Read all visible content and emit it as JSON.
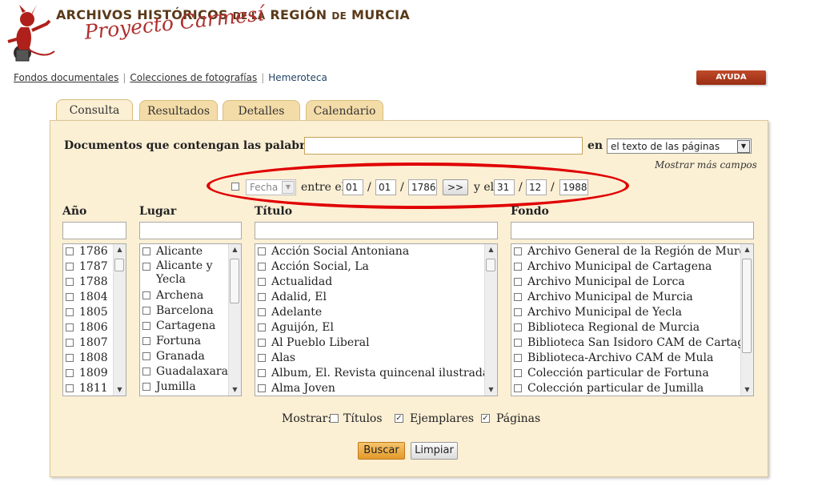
{
  "header": {
    "title_a": "ARCHIVOS HISTÓRICOS",
    "title_de1": "DE LA",
    "title_b": "REGIÓN",
    "title_de2": "DE",
    "title_c": "MURCIA",
    "subtitle": "Proyecto Carmesí"
  },
  "nav": {
    "items": [
      "Fondos documentales",
      "Colecciones de fotografías",
      "Hemeroteca"
    ],
    "help_label": "AYUDA"
  },
  "tabs": [
    "Consulta",
    "Resultados",
    "Detalles",
    "Calendario"
  ],
  "search": {
    "label": "Documentos que contengan las palabras",
    "value": "",
    "in_label": "en",
    "scope_value": "el texto de las páginas",
    "more_fields": "Mostrar más campos"
  },
  "date_filter": {
    "type_value": "Fecha",
    "between_label": "entre el",
    "from_day": "01",
    "from_month": "01",
    "from_year": "1786",
    "sep": "/",
    "jump_label": ">>",
    "and_label": "y el",
    "to_day": "31",
    "to_month": "12",
    "to_year": "1988"
  },
  "columns": {
    "year": {
      "title": "Año",
      "items": [
        "1786",
        "1787",
        "1788",
        "1804",
        "1805",
        "1806",
        "1807",
        "1808",
        "1809",
        "1811"
      ]
    },
    "place": {
      "title": "Lugar",
      "items": [
        "Alicante",
        "Alicante y Yecla",
        "Archena",
        "Barcelona",
        "Cartagena",
        "Fortuna",
        "Granada",
        "Guadalaxara",
        "Jumilla"
      ]
    },
    "title_col": {
      "title": "Título",
      "items": [
        "Acción Social Antoniana",
        "Acción Social, La",
        "Actualidad",
        "Adalid, El",
        "Adelante",
        "Aguijón, El",
        "Al Pueblo Liberal",
        "Alas",
        "Album, El. Revista quincenal ilustrada.",
        "Alma Joven"
      ]
    },
    "fund": {
      "title": "Fondo",
      "items": [
        "Archivo General de la Región de Murcia",
        "Archivo Municipal de Cartagena",
        "Archivo Municipal de Lorca",
        "Archivo Municipal de Murcia",
        "Archivo Municipal de Yecla",
        "Biblioteca Regional de Murcia",
        "Biblioteca San Isidoro CAM de Cartagena",
        "Biblioteca-Archivo CAM de Mula",
        "Colección particular de Fortuna",
        "Colección particular de Jumilla"
      ]
    }
  },
  "show": {
    "label": "Mostrar:",
    "options": [
      {
        "label": "Títulos",
        "checked": false
      },
      {
        "label": "Ejemplares",
        "checked": true
      },
      {
        "label": "Páginas",
        "checked": true
      }
    ]
  },
  "actions": {
    "search": "Buscar",
    "clear": "Limpiar"
  },
  "colors": {
    "panel": "#fbefd4",
    "tab": "#f4dca8",
    "annotation": "#e00000",
    "help": "#a8361a"
  }
}
